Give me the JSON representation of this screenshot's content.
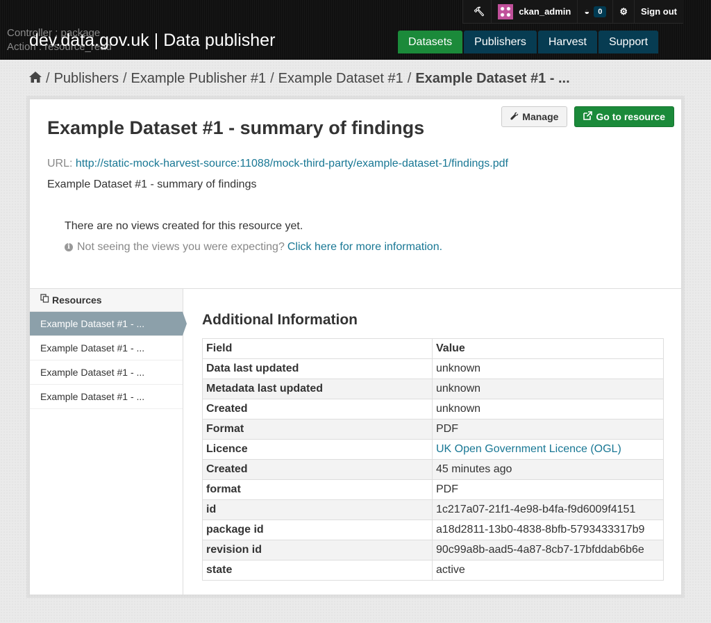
{
  "header": {
    "debug_controller": "Controller : package",
    "debug_action": "Action : resource_read",
    "site_title": "dev.data.gov.uk | Data publisher",
    "account": {
      "username": "ckan_admin",
      "dashboard_count": "0",
      "signout": "Sign out"
    },
    "nav": [
      {
        "label": "Datasets",
        "active": true
      },
      {
        "label": "Publishers",
        "active": false
      },
      {
        "label": "Harvest",
        "active": false
      },
      {
        "label": "Support",
        "active": false
      }
    ]
  },
  "breadcrumb": {
    "items": [
      "Publishers",
      "Example Publisher #1",
      "Example Dataset #1"
    ],
    "current": "Example Dataset #1 - ..."
  },
  "resource": {
    "actions": {
      "manage": "Manage",
      "go": "Go to resource"
    },
    "title": "Example Dataset #1 - summary of findings",
    "url_label": "URL:",
    "url": "http://static-mock-harvest-source:11088/mock-third-party/example-dataset-1/findings.pdf",
    "description": "Example Dataset #1 - summary of findings",
    "no_views": "There are no views created for this resource yet.",
    "help_text": "Not seeing the views you were expecting?",
    "help_link": "Click here for more information."
  },
  "sidebar": {
    "heading": "Resources",
    "items": [
      {
        "label": "Example Dataset #1 - ...",
        "active": true
      },
      {
        "label": "Example Dataset #1 - ...",
        "active": false
      },
      {
        "label": "Example Dataset #1 - ...",
        "active": false
      },
      {
        "label": "Example Dataset #1 - ...",
        "active": false
      }
    ]
  },
  "additional_info": {
    "heading": "Additional Information",
    "columns": [
      "Field",
      "Value"
    ],
    "rows": [
      {
        "field": "Data last updated",
        "value": "unknown"
      },
      {
        "field": "Metadata last updated",
        "value": "unknown"
      },
      {
        "field": "Created",
        "value": "unknown"
      },
      {
        "field": "Format",
        "value": "PDF"
      },
      {
        "field": "Licence",
        "value": "UK Open Government Licence (OGL)",
        "link": true
      },
      {
        "field": "Created",
        "value": "45 minutes ago"
      },
      {
        "field": "format",
        "value": "PDF"
      },
      {
        "field": "id",
        "value": "1c217a07-21f1-4e98-b4fa-f9d6009f4151"
      },
      {
        "field": "package id",
        "value": "a18d2811-13b0-4838-8bfb-5793433317b9"
      },
      {
        "field": "revision id",
        "value": "90c99a8b-aad5-4a87-8cb7-17bfddab6b6e"
      },
      {
        "field": "state",
        "value": "active"
      }
    ]
  },
  "colors": {
    "header_bg": "#101010",
    "nav_active": "#1b8a3a",
    "nav_default": "#073c52",
    "link": "#187794",
    "sidebar_active": "#8ca0aa"
  }
}
